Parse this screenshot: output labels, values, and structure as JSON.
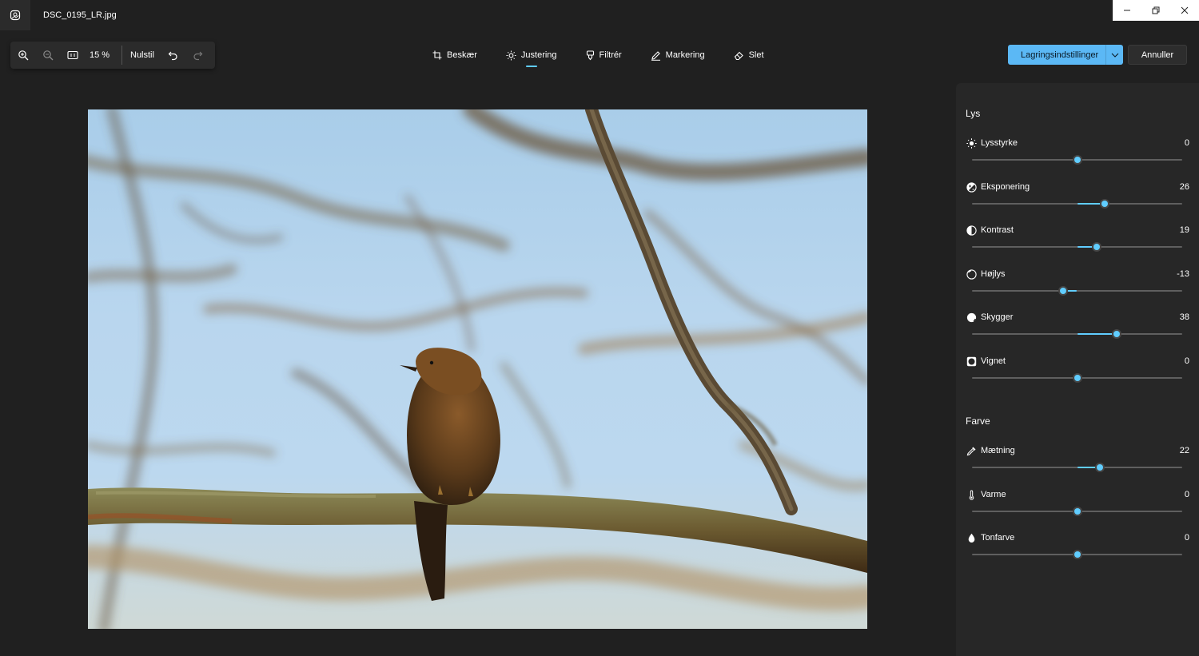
{
  "window": {
    "file_name": "DSC_0195_LR.jpg"
  },
  "zoom_toolbar": {
    "zoom_level": "15 %",
    "reset_label": "Nulstil"
  },
  "tabs": [
    {
      "label": "Beskær",
      "icon": "crop-icon",
      "active": false
    },
    {
      "label": "Justering",
      "icon": "brightness-icon",
      "active": true
    },
    {
      "label": "Filtrér",
      "icon": "filter-icon",
      "active": false
    },
    {
      "label": "Markering",
      "icon": "markup-pen-icon",
      "active": false
    },
    {
      "label": "Slet",
      "icon": "eraser-icon",
      "active": false
    }
  ],
  "actions": {
    "save_label": "Lagringsindstillinger",
    "cancel_label": "Annuller"
  },
  "panel": {
    "light_section": "Lys",
    "color_section": "Farve",
    "light": [
      {
        "label": "Lysstyrke",
        "value": "0",
        "level": 0,
        "icon": "sun-icon"
      },
      {
        "label": "Eksponering",
        "value": "26",
        "level": 26,
        "icon": "exposure-icon"
      },
      {
        "label": "Kontrast",
        "value": "19",
        "level": 19,
        "icon": "contrast-icon"
      },
      {
        "label": "Højlys",
        "value": "-13",
        "level": -13,
        "icon": "highlights-icon"
      },
      {
        "label": "Skygger",
        "value": "38",
        "level": 38,
        "icon": "shadows-icon"
      },
      {
        "label": "Vignet",
        "value": "0",
        "level": 0,
        "icon": "vignette-icon"
      }
    ],
    "color": [
      {
        "label": "Mætning",
        "value": "22",
        "level": 22,
        "icon": "eyedropper-icon"
      },
      {
        "label": "Varme",
        "value": "0",
        "level": 0,
        "icon": "thermometer-icon"
      },
      {
        "label": "Tonfarve",
        "value": "0",
        "level": 0,
        "icon": "droplet-icon"
      }
    ]
  },
  "colors": {
    "accent": "#60cdff",
    "save_button": "#5bb8f5",
    "background": "#202020",
    "panel": "#272727"
  }
}
